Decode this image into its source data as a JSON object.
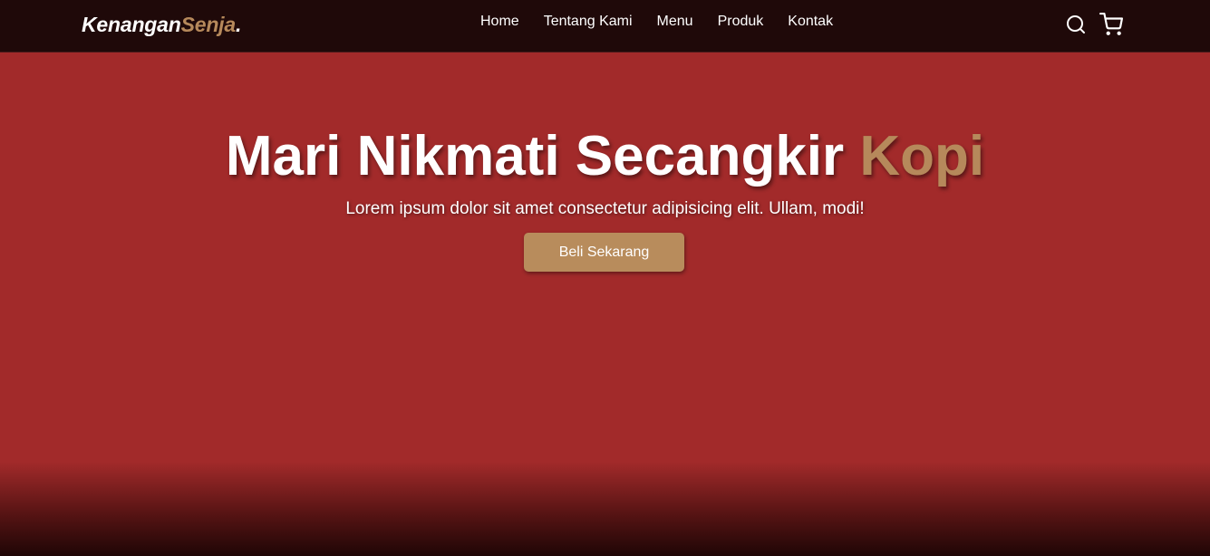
{
  "navbar": {
    "logo_main": "Kenangan",
    "logo_accent": "Senja",
    "logo_dot": ".",
    "links": [
      {
        "label": "Home"
      },
      {
        "label": "Tentang Kami"
      },
      {
        "label": "Menu"
      },
      {
        "label": "Produk"
      },
      {
        "label": "Kontak"
      }
    ],
    "icons": [
      "search-icon",
      "shopping-cart-icon"
    ]
  },
  "hero": {
    "title_main": "Mari Nikmati Secangkir ",
    "title_accent": "Kopi",
    "subtitle": "Lorem ipsum dolor sit amet consectetur adipisicing elit. Ullam, modi!",
    "cta_label": "Beli Sekarang"
  },
  "colors": {
    "navbar_bg": "#1f0909",
    "hero_bg": "#a22a2a",
    "accent": "#b6895b",
    "button_bg": "#b88c5c",
    "text": "#ffffff"
  }
}
